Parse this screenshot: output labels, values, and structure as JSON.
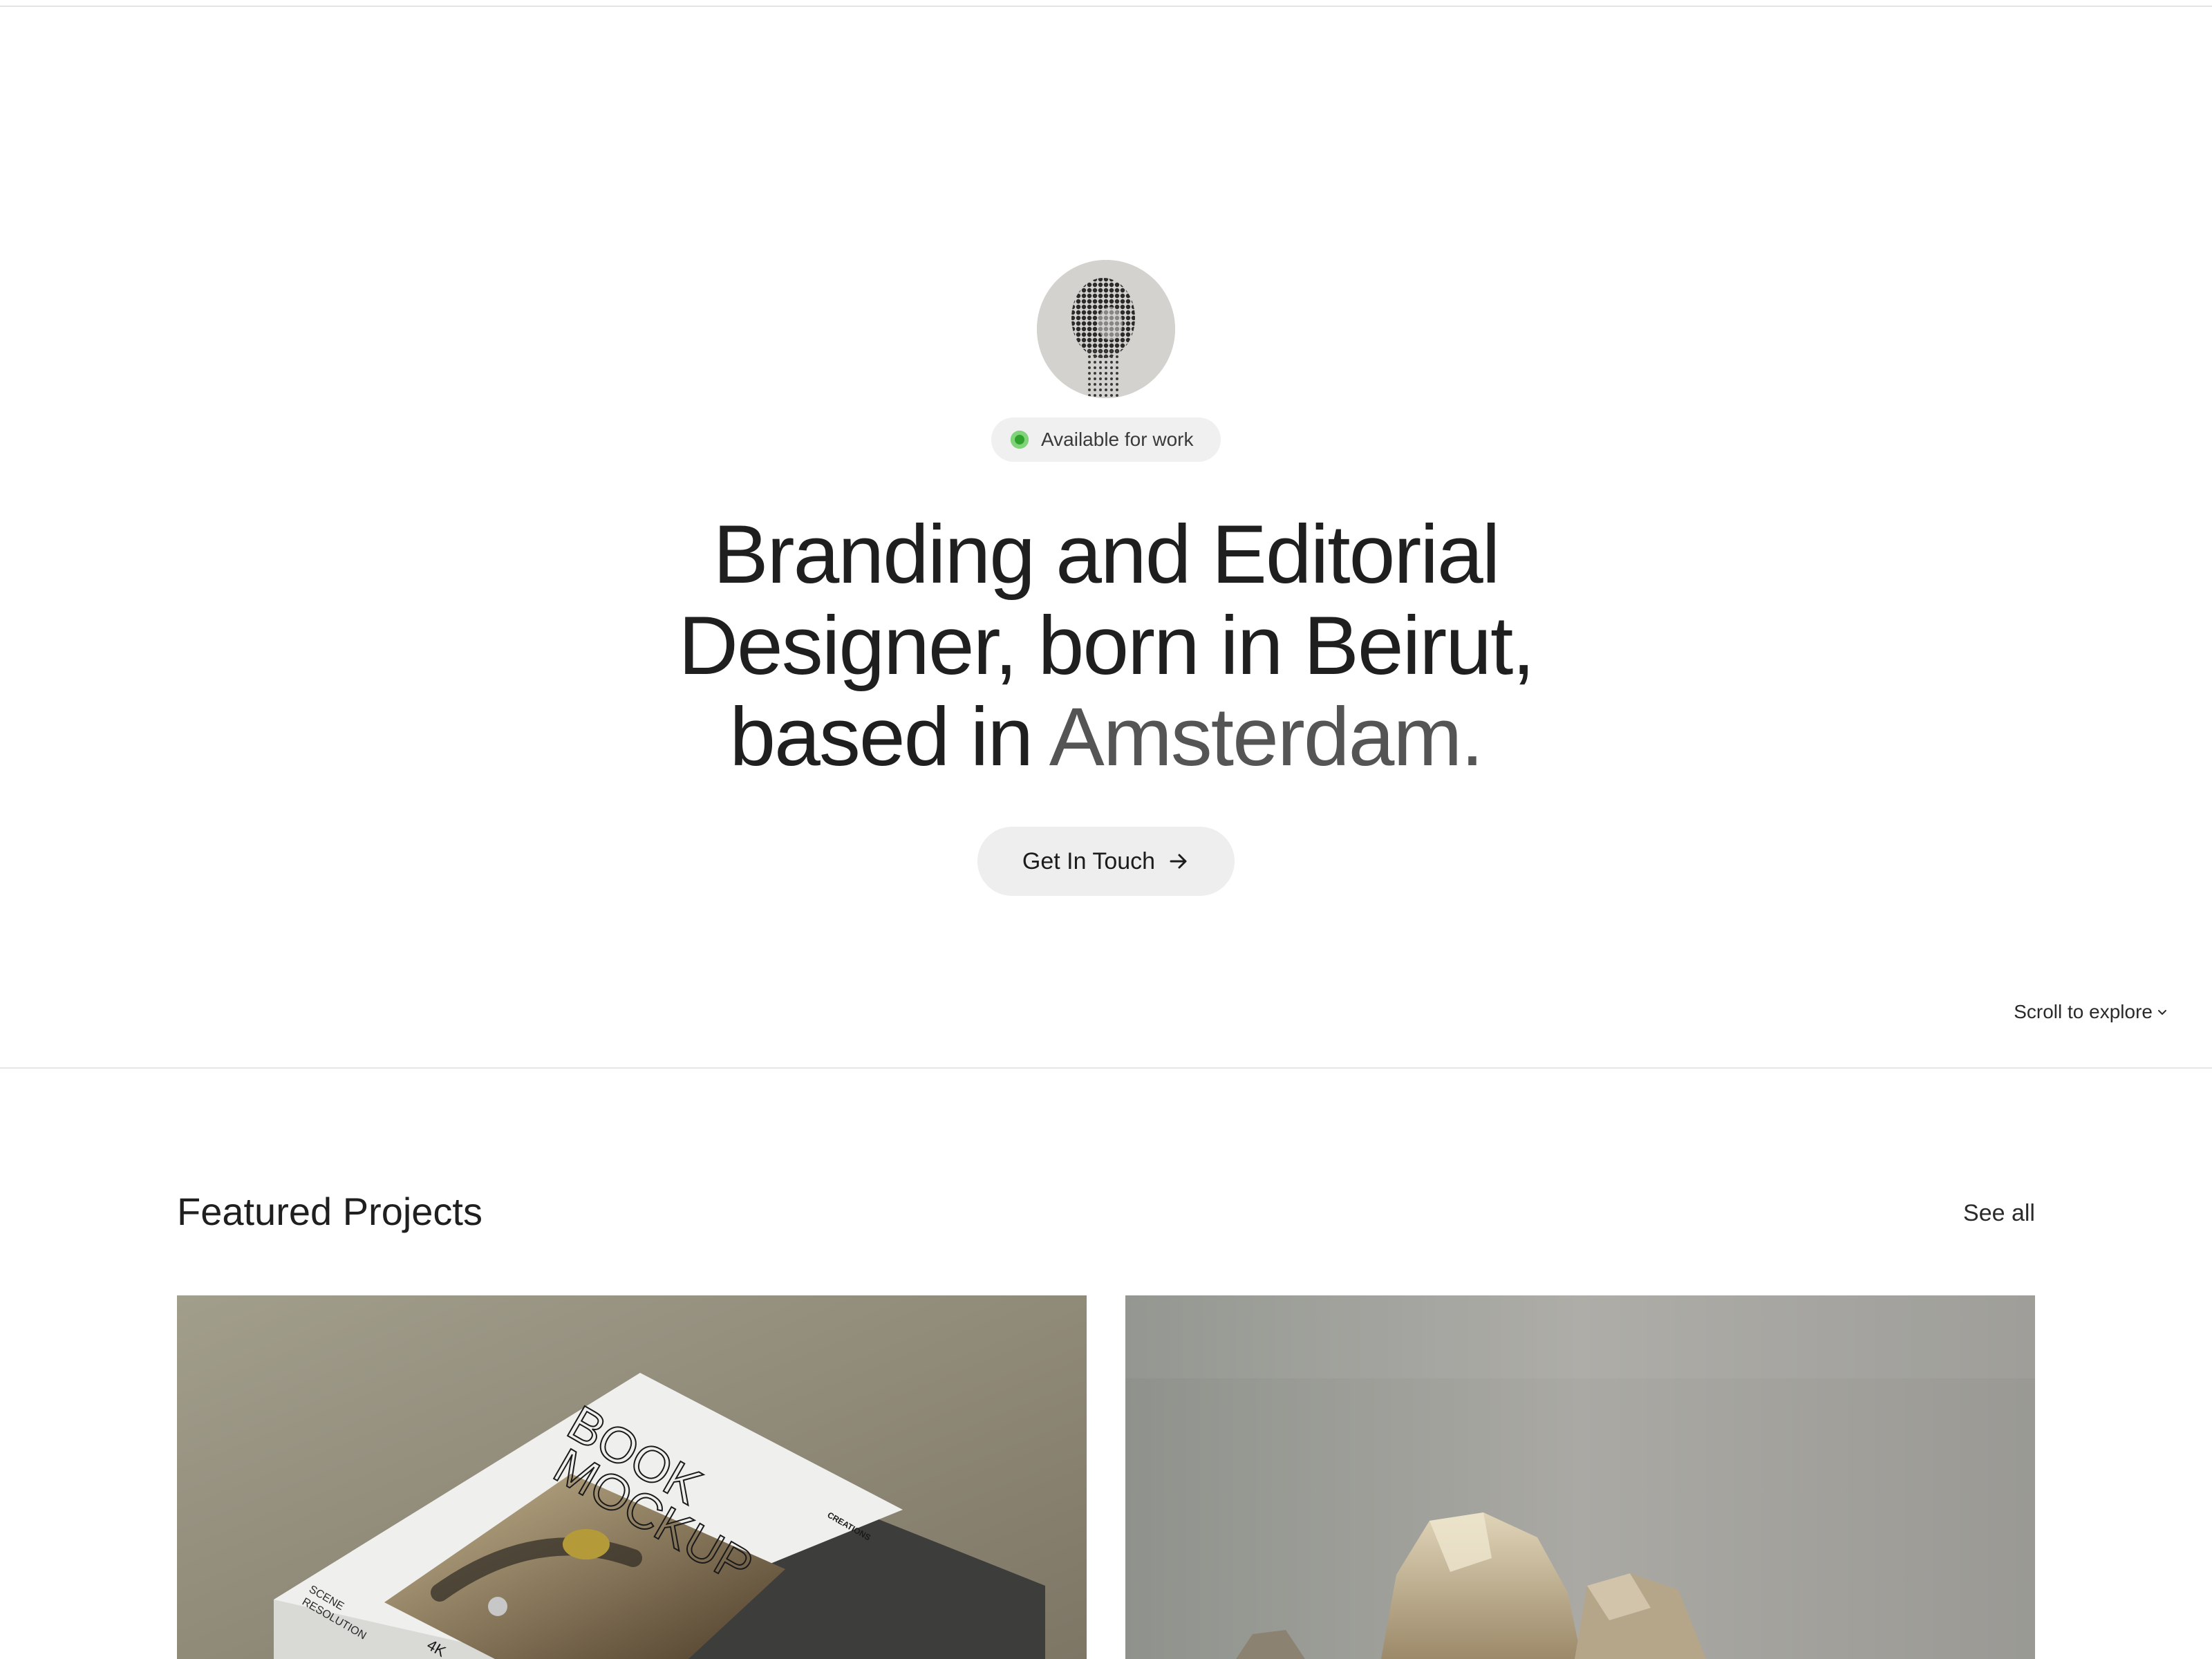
{
  "hero": {
    "status_label": "Available for work",
    "headline_main": "Branding and Editorial Designer, born in Beirut, based in ",
    "headline_highlight": "Amsterdam.",
    "cta_label": "Get In Touch",
    "scroll_hint": "Scroll to explore"
  },
  "projects": {
    "title": "Featured Projects",
    "see_all_label": "See all",
    "cards": [
      {
        "image": "book-mockup-image",
        "cover_title_line1": "BOOK",
        "cover_title_line2": "MOCKUP",
        "cover_brand": "CREATIONS",
        "cover_subtitle_line1": "SCENE",
        "cover_subtitle_line2": "RESOLUTION",
        "cover_badge": "4K"
      },
      {
        "image": "stone-sculpture-image"
      }
    ]
  },
  "colors": {
    "status_green": "#2fa12c",
    "accent_muted_text": "#555555",
    "chip_background": "#f0f0f0",
    "text": "#1f1f1f"
  },
  "icons": {
    "status": "status-dot-icon",
    "cta": "arrow-right-icon",
    "scroll": "chevron-down-icon"
  }
}
